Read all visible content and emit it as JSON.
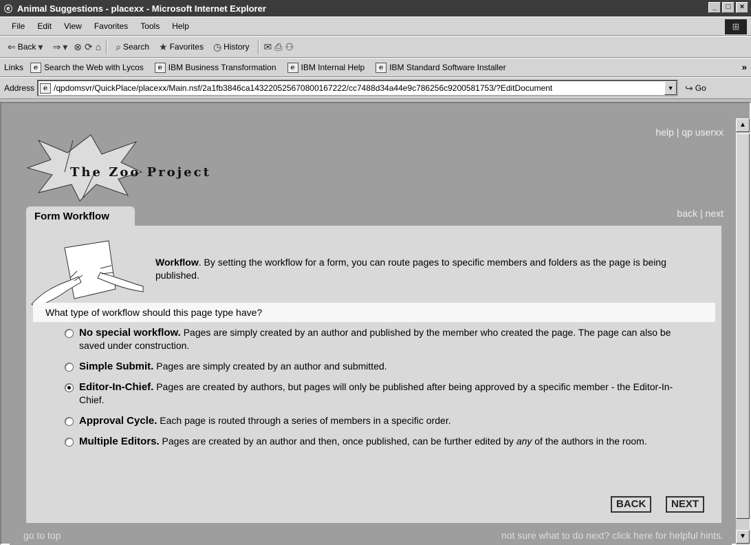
{
  "window": {
    "title": "Animal Suggestions - placexx - Microsoft Internet Explorer",
    "min_glyph": "_",
    "max_glyph": "□",
    "close_glyph": "×"
  },
  "menu": [
    "File",
    "Edit",
    "View",
    "Favorites",
    "Tools",
    "Help"
  ],
  "toolbar": {
    "back": "Back",
    "search": "Search",
    "favorites": "Favorites",
    "history": "History"
  },
  "links": {
    "label": "Links",
    "items": [
      "Search the Web with Lycos",
      "IBM Business Transformation",
      "IBM Internal Help",
      "IBM Standard Software Installer"
    ]
  },
  "address": {
    "label": "Address",
    "url": "/qpdomsvr/QuickPlace/placexx/Main.nsf/2a1fb3846ca14322052567080016722​2/cc7488d34a44e9c786256c9200581753/?EditDocument",
    "go": "Go"
  },
  "page": {
    "logo_text": "The Zoo Project",
    "help_link": "help",
    "user_link": "qp userxx",
    "separator": "|",
    "back_link": "back",
    "next_link": "next",
    "tab_label": "Form Workflow",
    "intro_bold": "Workflow",
    "intro_text": ". By setting the workflow for a form, you can route pages to specific members and folders as the page is being published.",
    "question": "What type of workflow should this page type have?",
    "options": [
      {
        "title": "No special workflow.",
        "text": " Pages are simply created by an author and published by the member who created the page. The page can also be saved under construction.",
        "checked": false
      },
      {
        "title": "Simple Submit.",
        "text": " Pages are simply created by an author and submitted.",
        "checked": false
      },
      {
        "title": "Editor-In-Chief.",
        "text": " Pages are created by authors, but pages will only be published after being approved by a specific member - the Editor-In-Chief.",
        "checked": true
      },
      {
        "title": "Approval Cycle.",
        "text": " Each page is routed through a series of members in a specific order.",
        "checked": false
      },
      {
        "title": "Multiple Editors.",
        "text_before": " Pages are created by an author and then, once published, can be further edited by ",
        "text_em": "any",
        "text_after": " of the authors in the room.",
        "checked": false
      }
    ],
    "back_button": "BACK",
    "next_button": "NEXT",
    "footer_left": "go to top",
    "footer_right": "not sure what to do next? click here for helpful hints."
  }
}
